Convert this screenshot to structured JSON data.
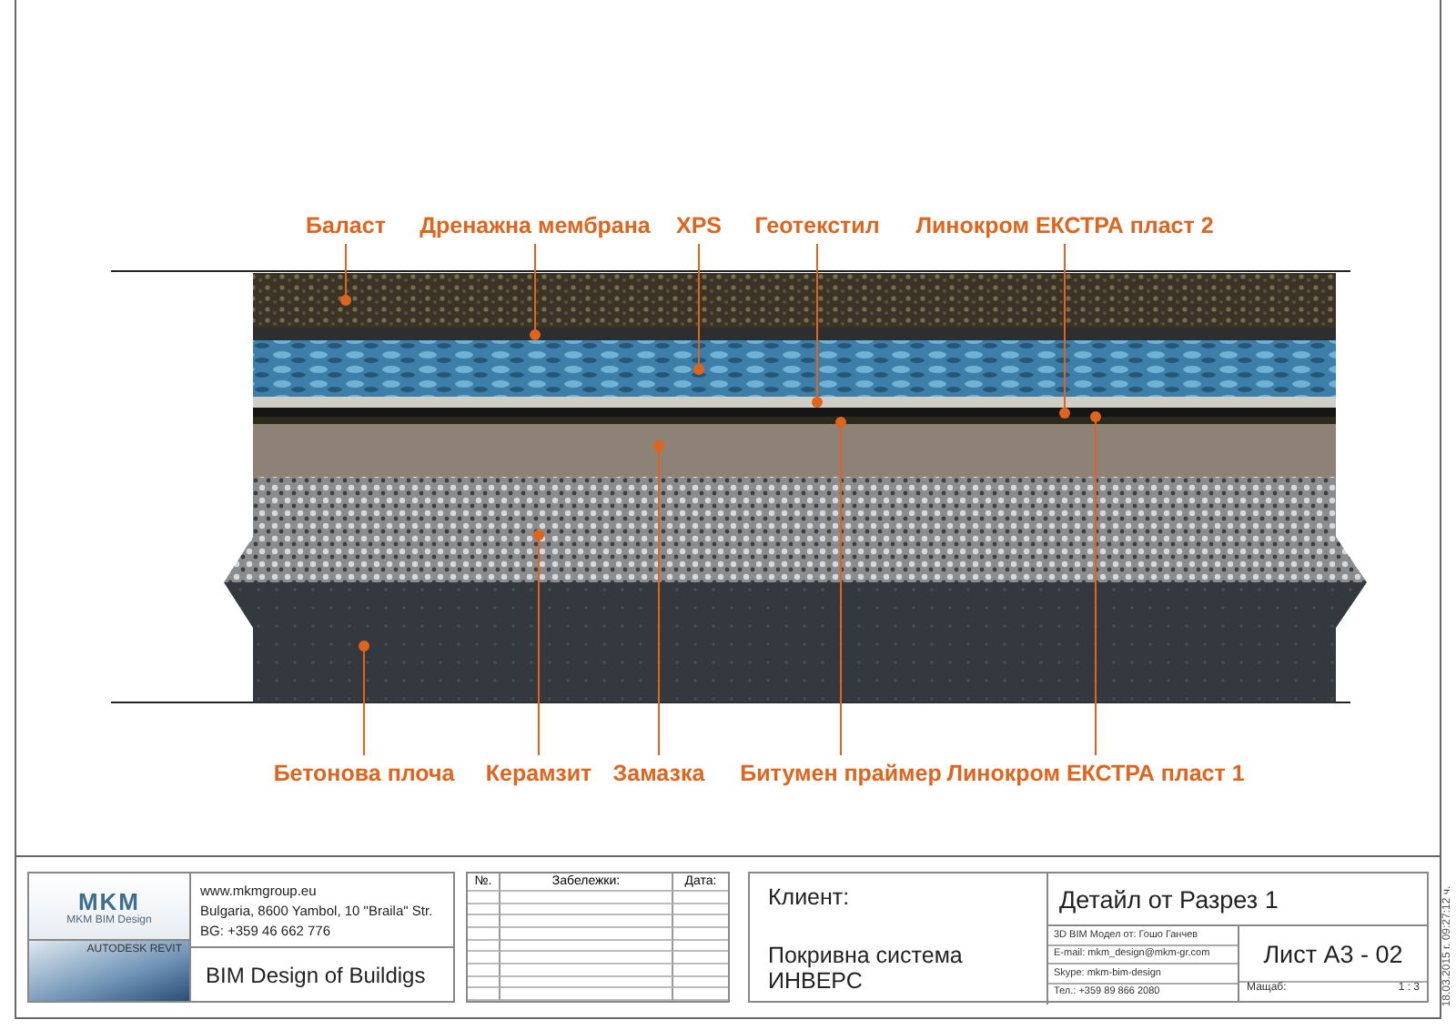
{
  "top_labels": [
    "Баласт",
    "Дренажна мембрана",
    "XPS",
    "Геотекстил",
    "Линокром ЕКСТРА пласт 2"
  ],
  "bottom_labels": [
    "Бетонова плоча",
    "Керамзит",
    "Замазка",
    "Битумен праймер",
    "Линокром ЕКСТРА пласт 1"
  ],
  "company": {
    "logo": "MKM",
    "logo_caption": "MKM BIM Design",
    "software": "AUTODESK REVIT",
    "address_lines": [
      "www.mkmgroup.eu",
      "Bulgaria, 8600 Yambol, 10 \"Braila\" Str.",
      "BG: +359 46  662 776"
    ],
    "slogan": "BIM Design of Buildigs"
  },
  "notes": {
    "columns": [
      "№.",
      "Забележки:",
      "Дата:"
    ]
  },
  "client": {
    "label": "Клиент:",
    "name": "Покривна система ИНВЕРС"
  },
  "sheet": {
    "title": "Детайл от Разрез 1",
    "contacts": [
      "3D BIM Модел от:   Гошо Ганчев",
      "E-mail: mkm_design@mkm-gr.com",
      "Skype: mkm-bim-design",
      "Тел.: +359 89 866 2080"
    ],
    "number": "Лист А3 - 02",
    "scale_label": "Мащаб:",
    "scale": "1 : 3"
  },
  "timestamp": "18.03.2015 г. 09:27:12 ч."
}
